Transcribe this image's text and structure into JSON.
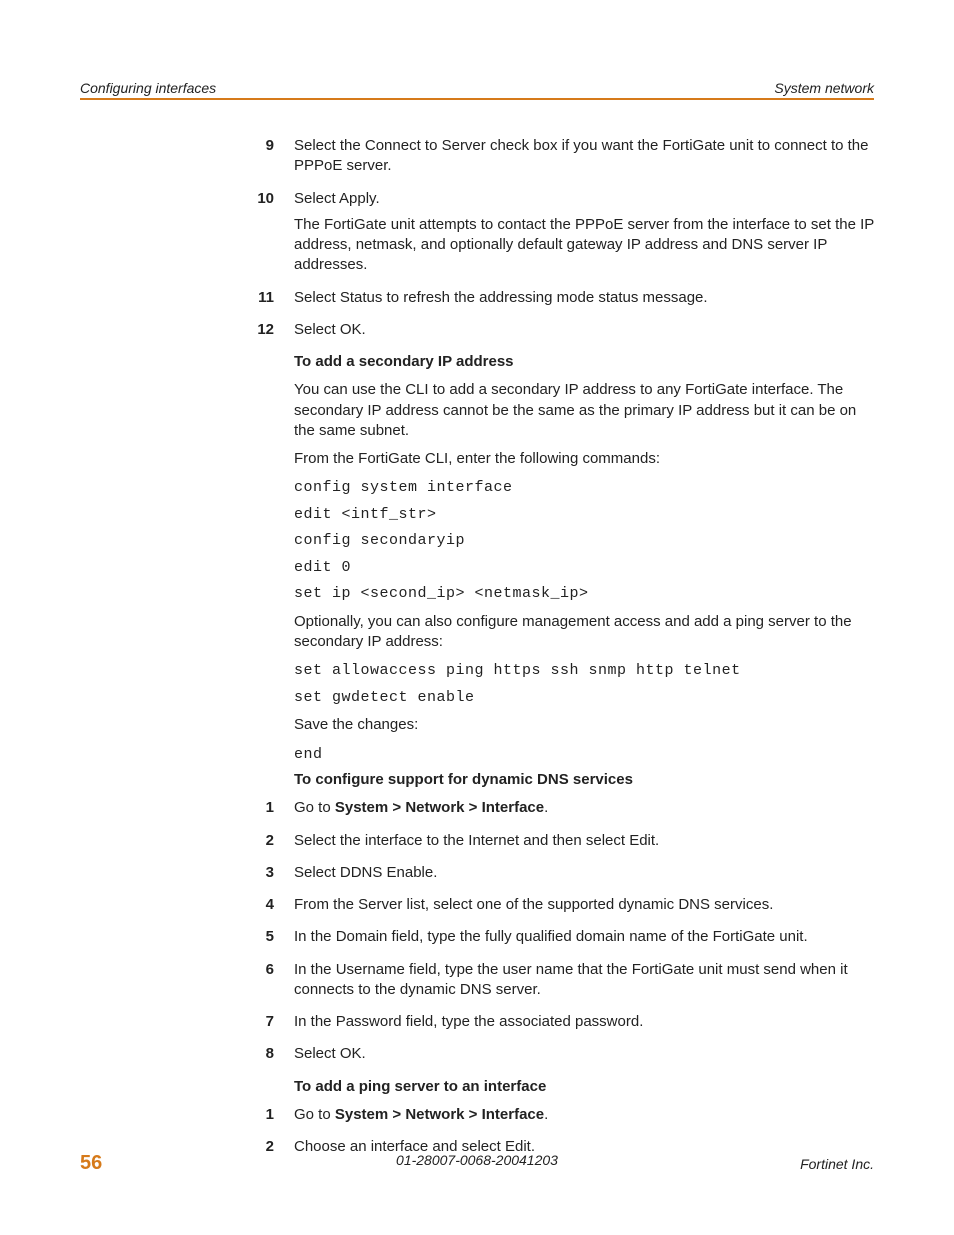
{
  "header": {
    "left": "Configuring interfaces",
    "right": "System network"
  },
  "steps_a": {
    "s9": {
      "n": "9",
      "t": "Select the Connect to Server check box if you want the FortiGate unit to connect to the PPPoE server."
    },
    "s10": {
      "n": "10",
      "t1": "Select Apply.",
      "t2": "The FortiGate unit attempts to contact the PPPoE server from the interface to set the IP address, netmask, and optionally default gateway IP address and DNS server IP addresses."
    },
    "s11": {
      "n": "11",
      "t": "Select Status to refresh the addressing mode status message."
    },
    "s12": {
      "n": "12",
      "t": "Select OK."
    }
  },
  "section_secondary": {
    "heading": "To add a secondary IP address",
    "p1": "You can use the CLI to add a secondary IP address to any FortiGate interface. The secondary IP address cannot be the same as the primary IP address but it can be on the same subnet.",
    "p2": "From the FortiGate CLI, enter the following commands:",
    "code1": [
      "config system interface",
      "edit <intf_str>",
      "config secondaryip",
      "edit 0",
      "set ip <second_ip> <netmask_ip>"
    ],
    "p3": "Optionally, you can also configure management access and add a ping server to the secondary IP address:",
    "code2": [
      "set allowaccess ping https ssh snmp http telnet",
      "set gwdetect enable"
    ],
    "p4": "Save the changes:",
    "code3": [
      "end"
    ]
  },
  "section_ddns": {
    "heading": "To configure support for dynamic DNS services",
    "steps": {
      "s1": {
        "n": "1",
        "prefix": "Go to ",
        "bold": "System > Network > Interface",
        "suffix": "."
      },
      "s2": {
        "n": "2",
        "t": "Select the interface to the Internet and then select Edit."
      },
      "s3": {
        "n": "3",
        "t": "Select DDNS Enable."
      },
      "s4": {
        "n": "4",
        "t": "From the Server list, select one of the supported dynamic DNS services."
      },
      "s5": {
        "n": "5",
        "t": "In the Domain field, type the fully qualified domain name of the FortiGate unit."
      },
      "s6": {
        "n": "6",
        "t": "In the Username field, type the user name that the FortiGate unit must send when it connects to the dynamic DNS server."
      },
      "s7": {
        "n": "7",
        "t": "In the Password field, type the associated password."
      },
      "s8": {
        "n": "8",
        "t": "Select OK."
      }
    }
  },
  "section_ping": {
    "heading": "To add a ping server to an interface",
    "steps": {
      "s1": {
        "n": "1",
        "prefix": "Go to ",
        "bold": "System > Network > Interface",
        "suffix": "."
      },
      "s2": {
        "n": "2",
        "t": "Choose an interface and select Edit."
      }
    }
  },
  "footer": {
    "page": "56",
    "center": "01-28007-0068-20041203",
    "right": "Fortinet Inc."
  }
}
